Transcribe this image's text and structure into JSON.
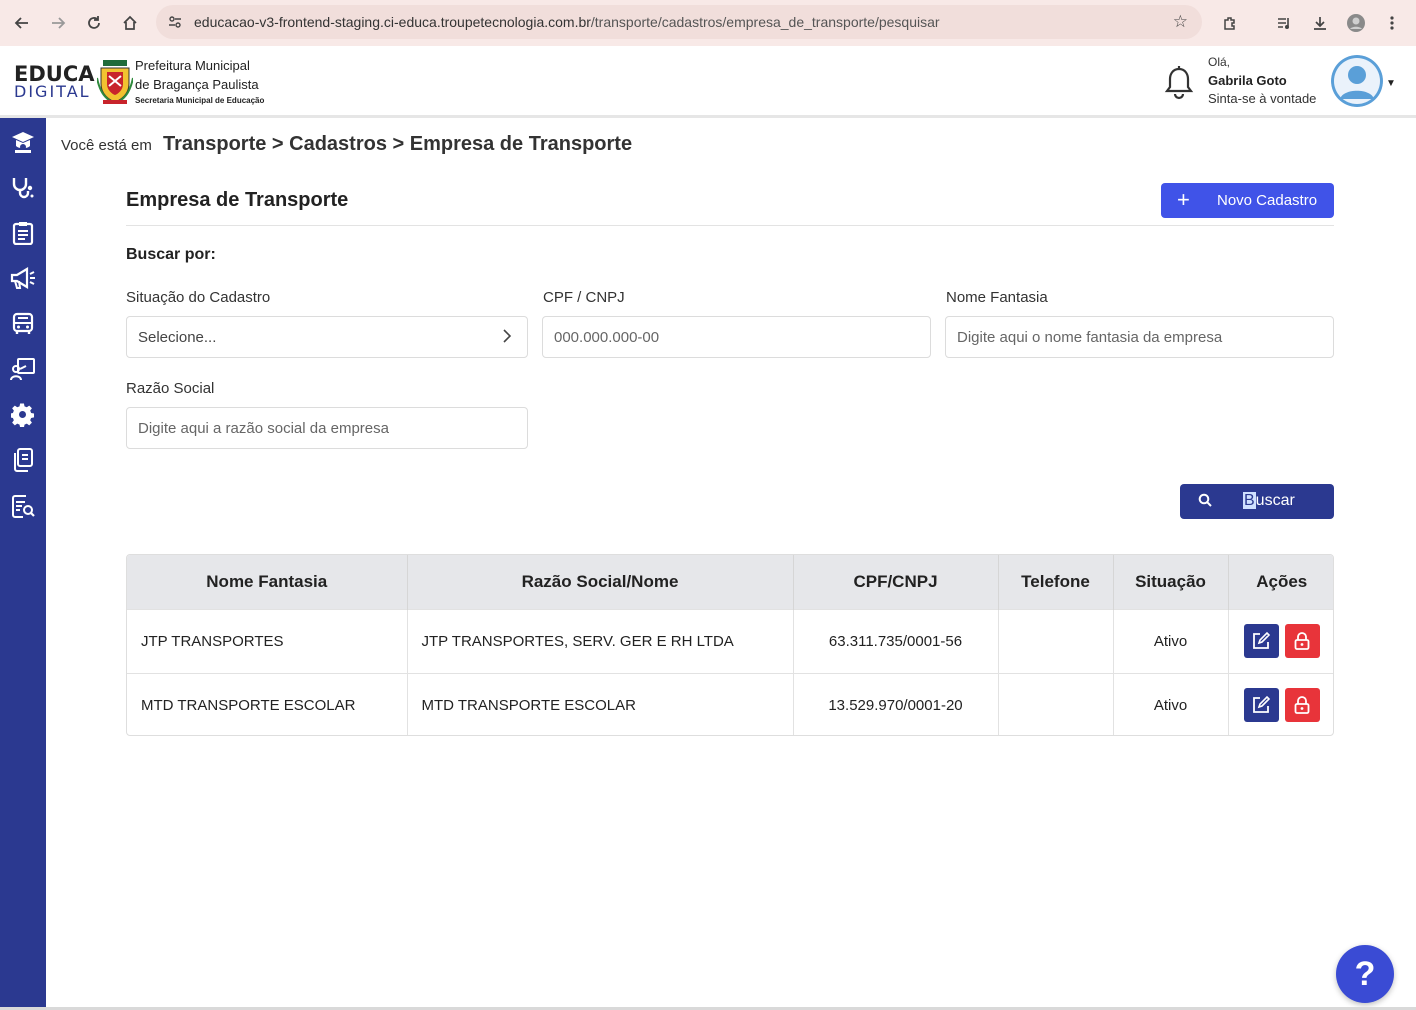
{
  "browser": {
    "url_domain": "educacao-v3-frontend-staging.ci-educa.troupetecnologia.com.br",
    "url_path": "/transporte/cadastros/empresa_de_transporte/pesquisar"
  },
  "header": {
    "logo_top": "EDUCA",
    "logo_bottom": "DIGITAL",
    "prefeitura_line1": "Prefeitura Municipal",
    "prefeitura_line2": "de Bragança Paulista",
    "prefeitura_line3": "Secretaria Municipal de Educação",
    "greeting": "Olá,",
    "user_name": "Gabrila Goto",
    "greeting_sub": "Sinta-se à vontade"
  },
  "sidebar": {
    "icons": [
      "graduation-icon",
      "stethoscope-icon",
      "clipboard-icon",
      "megaphone-icon",
      "bus-icon",
      "teacher-board-icon",
      "gear-icon",
      "documents-icon",
      "report-search-icon"
    ]
  },
  "breadcrumb": {
    "prefix": "Você está em",
    "path": "Transporte > Cadastros > Empresa de Transporte"
  },
  "page": {
    "title": "Empresa de Transporte",
    "new_button": "Novo Cadastro",
    "search_heading": "Buscar por:"
  },
  "filters": {
    "situacao_label": "Situação do Cadastro",
    "situacao_value": "Selecione...",
    "cpf_label": "CPF / CNPJ",
    "cpf_placeholder": "000.000.000-00",
    "fantasia_label": "Nome Fantasia",
    "fantasia_placeholder": "Digite aqui o nome fantasia da empresa",
    "razao_label": "Razão Social",
    "razao_placeholder": "Digite aqui a razão social da empresa",
    "search_button_first": "B",
    "search_button_rest": "uscar"
  },
  "table": {
    "columns": [
      "Nome Fantasia",
      "Razão Social/Nome",
      "CPF/CNPJ",
      "Telefone",
      "Situação",
      "Ações"
    ],
    "rows": [
      {
        "fantasia": "JTP TRANSPORTES",
        "razao": "JTP TRANSPORTES, SERV. GER E RH LTDA",
        "cnpj": "63.311.735/0001-56",
        "telefone": "",
        "situacao": "Ativo"
      },
      {
        "fantasia": "MTD TRANSPORTE ESCOLAR",
        "razao": "MTD TRANSPORTE ESCOLAR",
        "cnpj": "13.529.970/0001-20",
        "telefone": "",
        "situacao": "Ativo"
      }
    ]
  },
  "help": {
    "label": "?"
  },
  "colors": {
    "primary": "#2b3990",
    "accent": "#4053e8",
    "danger": "#e8343a"
  }
}
